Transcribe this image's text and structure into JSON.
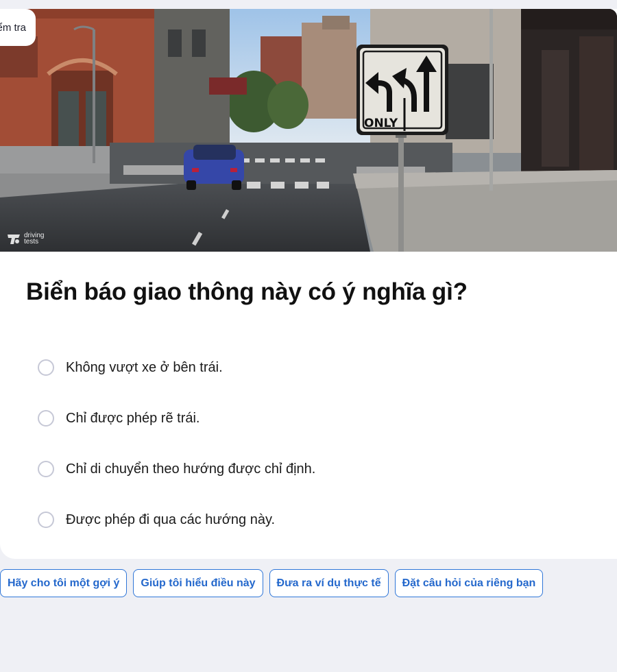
{
  "back_chip": {
    "label": "Kiểm tra"
  },
  "image": {
    "sign_text": "ONLY",
    "watermark": "driving tests"
  },
  "question": {
    "text": "Biển báo giao thông này có ý nghĩa gì?"
  },
  "options": [
    {
      "label": "Không vượt xe ở bên trái."
    },
    {
      "label": "Chỉ được phép rẽ trái."
    },
    {
      "label": "Chỉ di chuyển theo hướng được chỉ định."
    },
    {
      "label": "Được phép đi qua các hướng này."
    }
  ],
  "suggestions": [
    {
      "label": "Hãy cho tôi một gợi ý"
    },
    {
      "label": "Giúp tôi hiểu điều này"
    },
    {
      "label": "Đưa ra ví dụ thực tế"
    },
    {
      "label": "Đặt câu hỏi của riêng bạn"
    }
  ],
  "colors": {
    "page_bg": "#eff0f5",
    "accent": "#2f76d8",
    "radio_border": "#c6c8d6"
  }
}
